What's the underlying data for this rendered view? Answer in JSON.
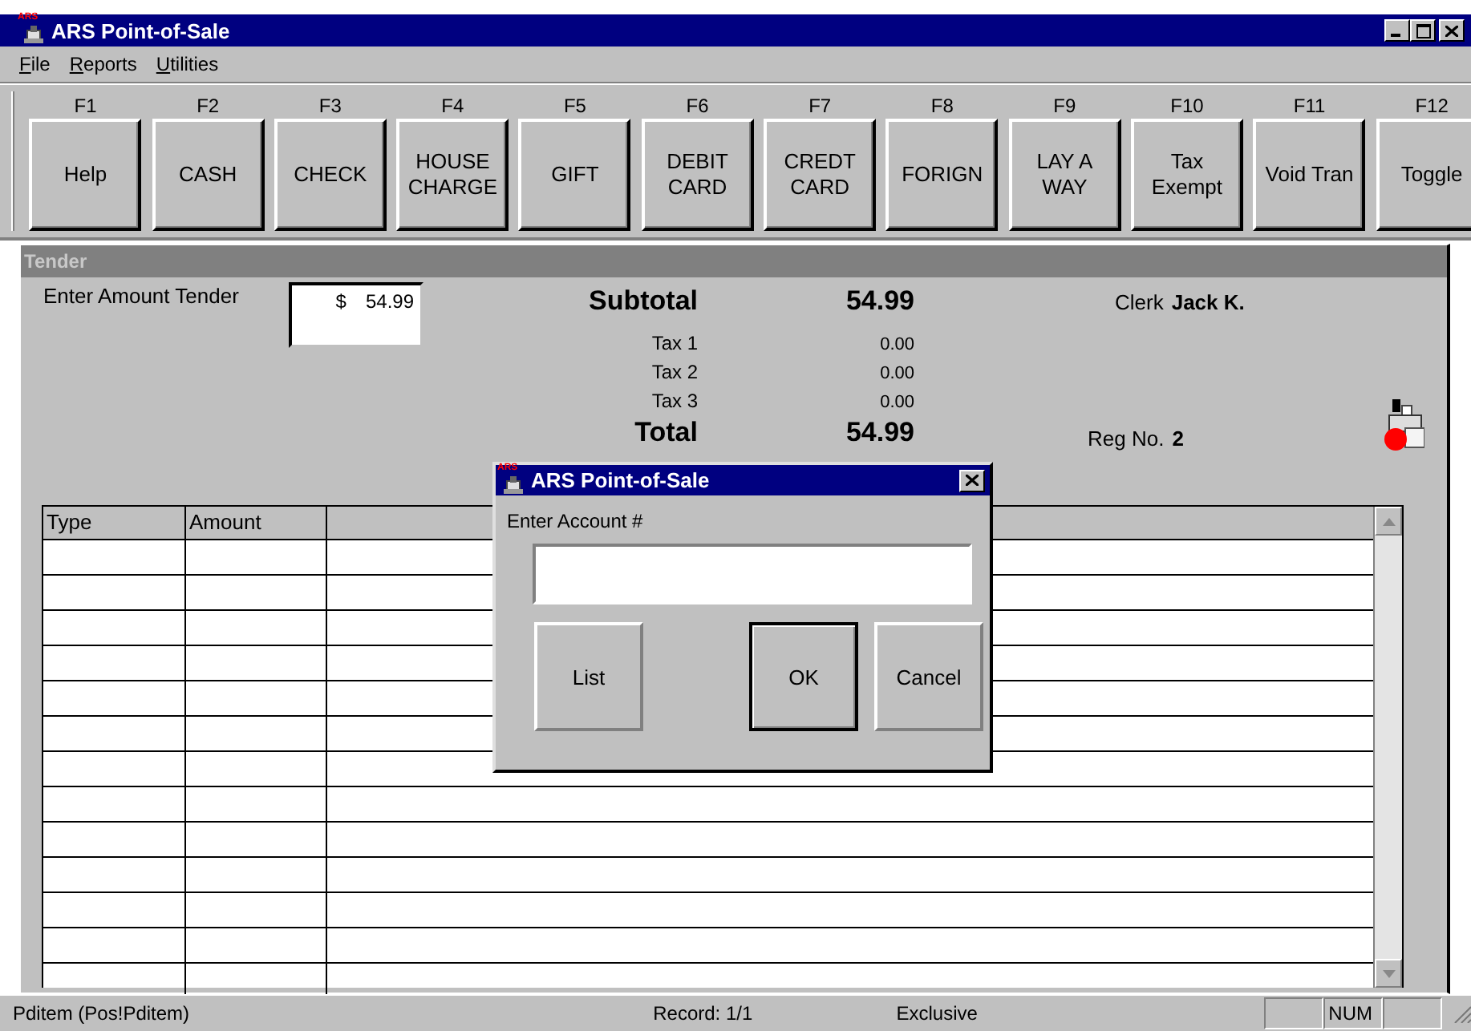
{
  "window": {
    "title": "ARS Point-of-Sale",
    "icon_text": "ARS"
  },
  "menu": [
    "File",
    "Reports",
    "Utilities"
  ],
  "function_keys": [
    {
      "key": "F1",
      "label": "Help"
    },
    {
      "key": "F2",
      "label": "CASH"
    },
    {
      "key": "F3",
      "label": "CHECK"
    },
    {
      "key": "F4",
      "label": "HOUSE CHARGE"
    },
    {
      "key": "F5",
      "label": "GIFT"
    },
    {
      "key": "F6",
      "label": "DEBIT CARD"
    },
    {
      "key": "F7",
      "label": "CREDT CARD"
    },
    {
      "key": "F8",
      "label": "FORIGN"
    },
    {
      "key": "F9",
      "label": "LAY A WAY"
    },
    {
      "key": "F10",
      "label": "Tax Exempt"
    },
    {
      "key": "F11",
      "label": "Void Tran"
    },
    {
      "key": "F12",
      "label": "Toggle"
    }
  ],
  "tender": {
    "title": "Tender",
    "amount_label": "Enter Amount Tender",
    "currency": "$",
    "amount": "54.99",
    "totals": [
      {
        "label": "Subtotal",
        "value": "54.99",
        "kind": "major"
      },
      {
        "label": "Tax 1",
        "value": "0.00",
        "kind": "minor"
      },
      {
        "label": "Tax 2",
        "value": "0.00",
        "kind": "minor"
      },
      {
        "label": "Tax 3",
        "value": "0.00",
        "kind": "minor"
      },
      {
        "label": "Total",
        "value": "54.99",
        "kind": "major"
      }
    ],
    "clerk_label": "Clerk",
    "clerk": "Jack K.",
    "reg_label": "Reg No.",
    "reg": "2"
  },
  "table": {
    "columns": [
      "Type",
      "Amount"
    ]
  },
  "dialog": {
    "title": "ARS Point-of-Sale",
    "icon_text": "ARS",
    "label": "Enter Account #",
    "buttons": [
      {
        "label": "List",
        "default": false
      },
      {
        "label": "OK",
        "default": true
      },
      {
        "label": "Cancel",
        "default": false
      }
    ]
  },
  "status_bar": {
    "panes": [
      "Pditem (Pos!Pditem)",
      "Record: 1/1",
      "Exclusive"
    ],
    "indicator": "NUM"
  }
}
